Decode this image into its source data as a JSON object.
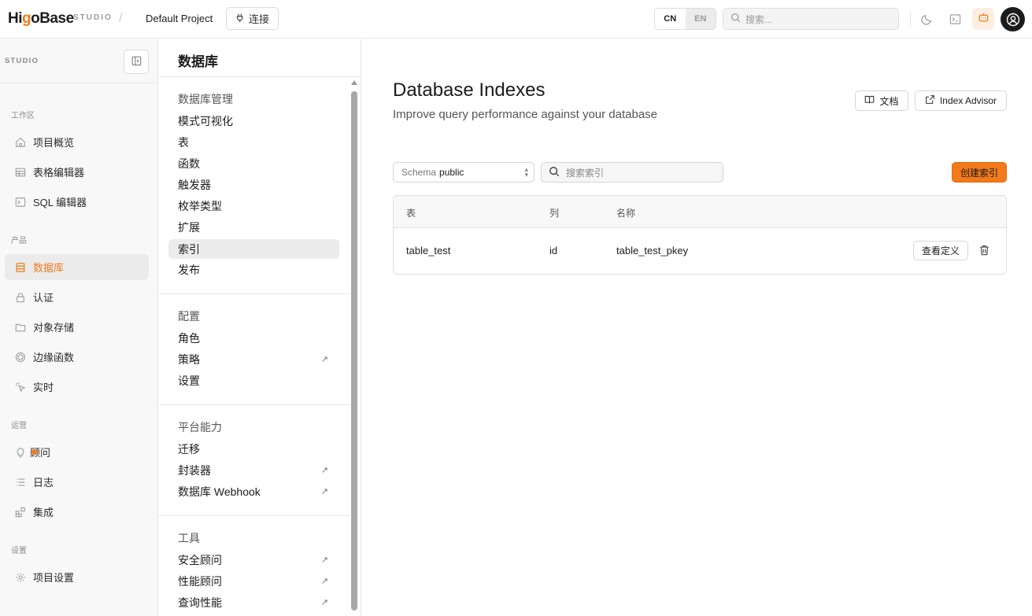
{
  "header": {
    "logo_prefix": "Hi",
    "logo_o": "g",
    "logo_rest": "oBase",
    "studio_tag": "STUDIO",
    "separator": "/",
    "project_name": "Default Project",
    "connect_label": "连接",
    "lang_cn": "CN",
    "lang_en": "EN",
    "search_placeholder": "搜索..."
  },
  "sidebar": {
    "studio_label": "STUDIO",
    "sections": {
      "workspace": "工作区",
      "product": "产品",
      "ops": "运营",
      "settings": "设置"
    },
    "items": {
      "overview": "项目概览",
      "table_editor": "表格编辑器",
      "sql_editor": "SQL 编辑器",
      "database": "数据库",
      "auth": "认证",
      "storage": "对象存储",
      "edge_functions": "边缘函数",
      "realtime": "实时",
      "advisors": "顾问",
      "logs": "日志",
      "integrations": "集成",
      "project_settings": "项目设置"
    }
  },
  "panel": {
    "title": "数据库",
    "groups": {
      "management": "数据库管理",
      "config": "配置",
      "platform": "平台能力",
      "tools": "工具"
    },
    "items": {
      "schema_visualizer": "模式可视化",
      "tables": "表",
      "functions": "函数",
      "triggers": "触发器",
      "enum_types": "枚举类型",
      "extensions": "扩展",
      "indexes": "索引",
      "publications": "发布",
      "roles": "角色",
      "policies": "策略",
      "settings": "设置",
      "migrations": "迁移",
      "wrappers": "封装器",
      "webhooks": "数据库 Webhook",
      "security_advisor": "安全顾问",
      "performance_advisor": "性能顾问",
      "query_performance": "查询性能"
    },
    "arrow": "↗"
  },
  "main": {
    "title": "Database Indexes",
    "subtitle": "Improve query performance against your database",
    "docs_label": "文档",
    "advisor_label": "Index Advisor",
    "schema_key": "Schema",
    "schema_value": "public",
    "search_placeholder": "搜索索引",
    "create_label": "创建索引",
    "columns": [
      "表",
      "列",
      "名称"
    ],
    "rows": [
      {
        "table": "table_test",
        "column": "id",
        "name": "table_test_pkey",
        "action": "查看定义"
      }
    ]
  },
  "colors": {
    "accent": "#f27a1a",
    "text": "#1c1c1c"
  }
}
